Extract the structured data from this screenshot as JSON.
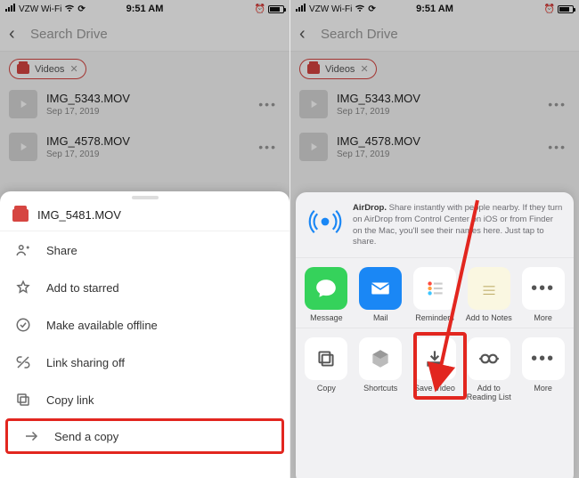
{
  "status": {
    "carrier": "VZW Wi-Fi",
    "time": "9:51 AM"
  },
  "search": {
    "placeholder": "Search Drive"
  },
  "chip": {
    "label": "Videos"
  },
  "files": [
    {
      "name": "IMG_5343.MOV",
      "date": "Sep 17, 2019"
    },
    {
      "name": "IMG_4578.MOV",
      "date": "Sep 17, 2019"
    }
  ],
  "selected_file": "IMG_5481.MOV",
  "menu": {
    "share": "Share",
    "star": "Add to starred",
    "offline": "Make available offline",
    "linkoff": "Link sharing off",
    "copylink": "Copy link",
    "sendcopy": "Send a copy"
  },
  "airdrop": {
    "title": "AirDrop.",
    "body": "Share instantly with people nearby. If they turn on AirDrop from Control Center on iOS or from Finder on the Mac, you'll see their names here. Just tap to share."
  },
  "share_apps": {
    "message": "Message",
    "mail": "Mail",
    "reminders": "Reminders",
    "notes": "Add to Notes",
    "more": "More"
  },
  "share_actions": {
    "copy": "Copy",
    "shortcuts": "Shortcuts",
    "savevideo": "Save Video",
    "readlist": "Add to Reading List",
    "more": "More"
  }
}
